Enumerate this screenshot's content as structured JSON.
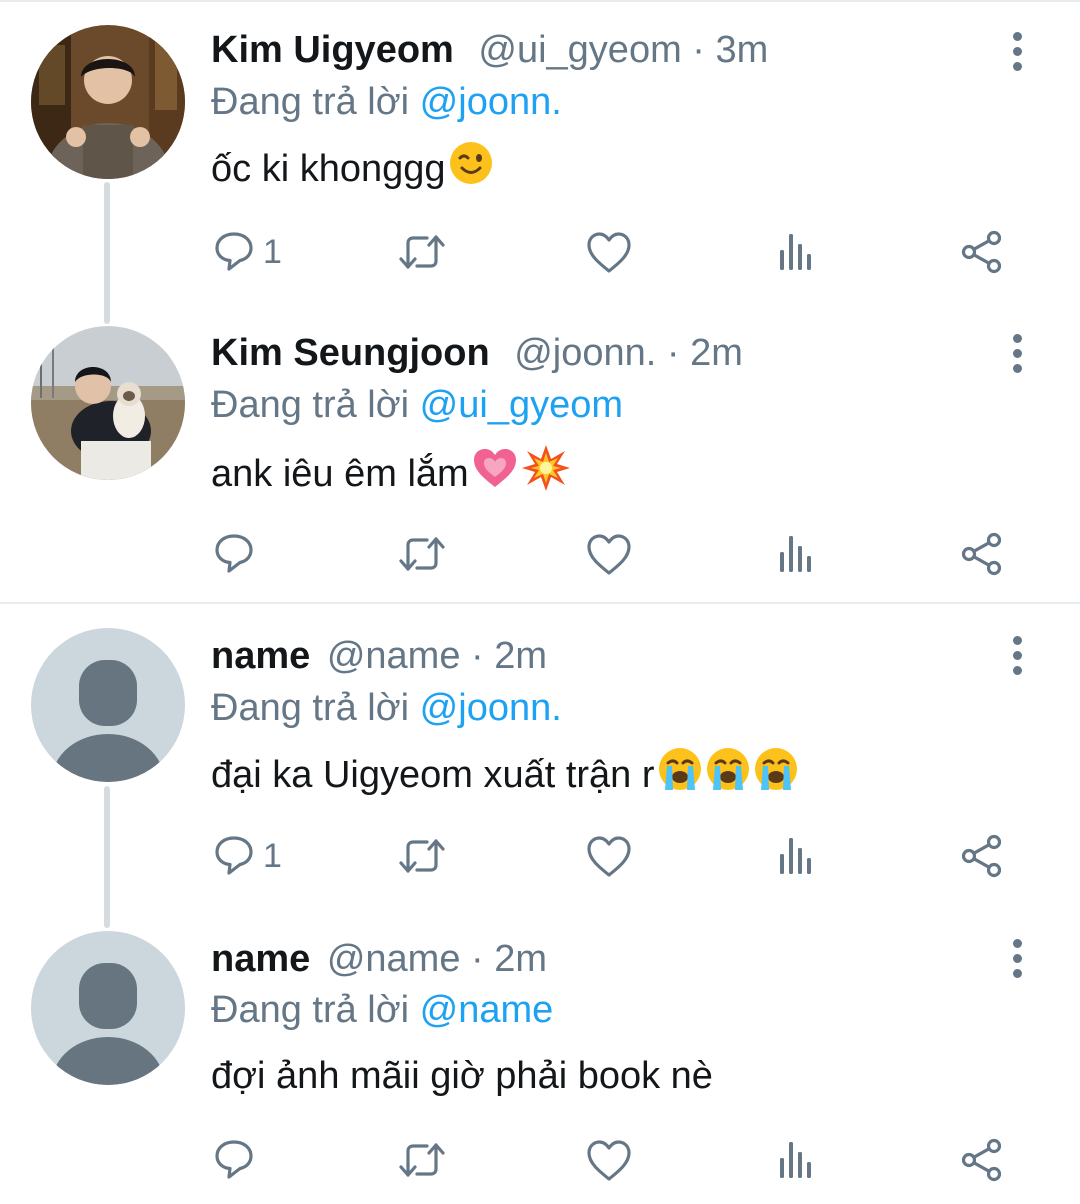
{
  "tweets": [
    {
      "name": "Kim Uigyeom",
      "handle": "@ui_gyeom",
      "sep": "·",
      "time": "3m",
      "reply_prefix": "Đang trả lời",
      "reply_to": "@joonn.",
      "text": "ốc ki khonggg",
      "emojis": [
        "winking-face"
      ],
      "reply_count": "1",
      "avatar": "photo"
    },
    {
      "name": "Kim Seungjoon",
      "handle": "@joonn.",
      "sep": "·",
      "time": "2m",
      "reply_prefix": "Đang trả lời",
      "reply_to": "@ui_gyeom",
      "text": "ank iêu êm lắm",
      "emojis": [
        "growing-heart",
        "collision"
      ],
      "reply_count": "",
      "avatar": "photo"
    },
    {
      "name": "name",
      "handle": "@name",
      "sep": "·",
      "time": "2m",
      "reply_prefix": "Đang trả lời",
      "reply_to": "@joonn.",
      "text": "đại ka Uigyeom xuất trận r",
      "emojis": [
        "loudly-crying-face",
        "loudly-crying-face",
        "loudly-crying-face"
      ],
      "reply_count": "1",
      "avatar": "default"
    },
    {
      "name": "name",
      "handle": "@name",
      "sep": "·",
      "time": "2m",
      "reply_prefix": "Đang trả lời",
      "reply_to": "@name",
      "text": "đợi ảnh mãii giờ phải book nè",
      "emojis": [],
      "reply_count": "",
      "avatar": "default"
    }
  ],
  "icons": {
    "reply": "reply-icon",
    "retweet": "retweet-icon",
    "like": "heart-icon",
    "analytics": "analytics-icon",
    "share": "share-icon",
    "more": "more-vertical-icon"
  },
  "colors": {
    "mention": "#1da1f2",
    "muted": "#657786",
    "text": "#14171a",
    "line": "#d4dbe1",
    "default_avatar_bg": "#ccd6dd",
    "default_avatar_fg": "#66757f"
  }
}
